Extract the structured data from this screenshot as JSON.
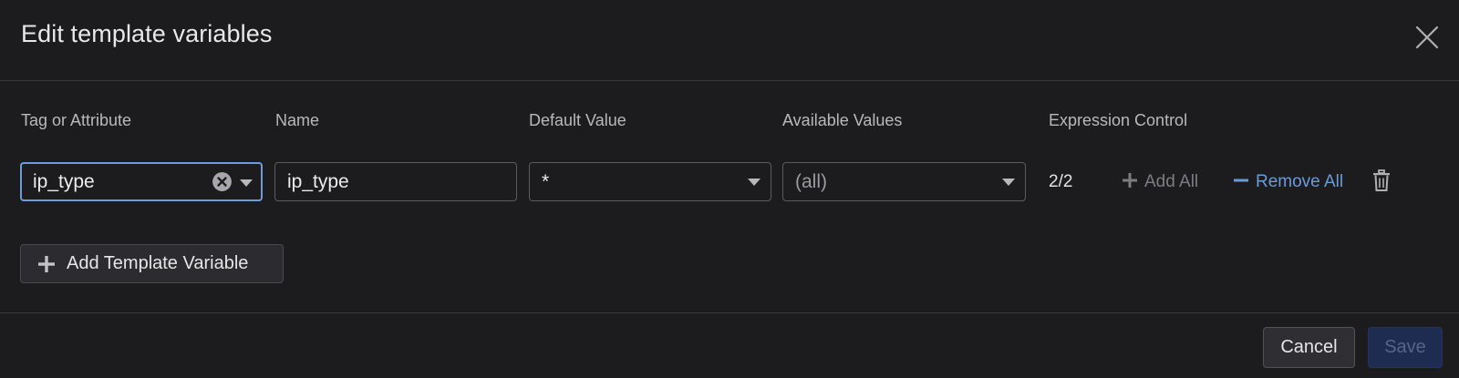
{
  "dialog": {
    "title": "Edit template variables",
    "close_icon": "close-icon"
  },
  "columns": {
    "tag_or_attribute": "Tag or Attribute",
    "name": "Name",
    "default_value": "Default Value",
    "available_values": "Available Values",
    "expression_control": "Expression Control"
  },
  "row": {
    "tag_value": "ip_type",
    "name_value": "ip_type",
    "default_value": "*",
    "available_values": "(all)",
    "count": "2/2",
    "add_all": "Add All",
    "remove_all": "Remove All"
  },
  "add_template_variable": "Add Template Variable",
  "footer": {
    "cancel": "Cancel",
    "save": "Save"
  },
  "colors": {
    "background": "#1c1c1f",
    "focus_border": "#6f9bd8",
    "link_blue": "#6a9ad8",
    "save_disabled_bg": "#1e2c52"
  }
}
